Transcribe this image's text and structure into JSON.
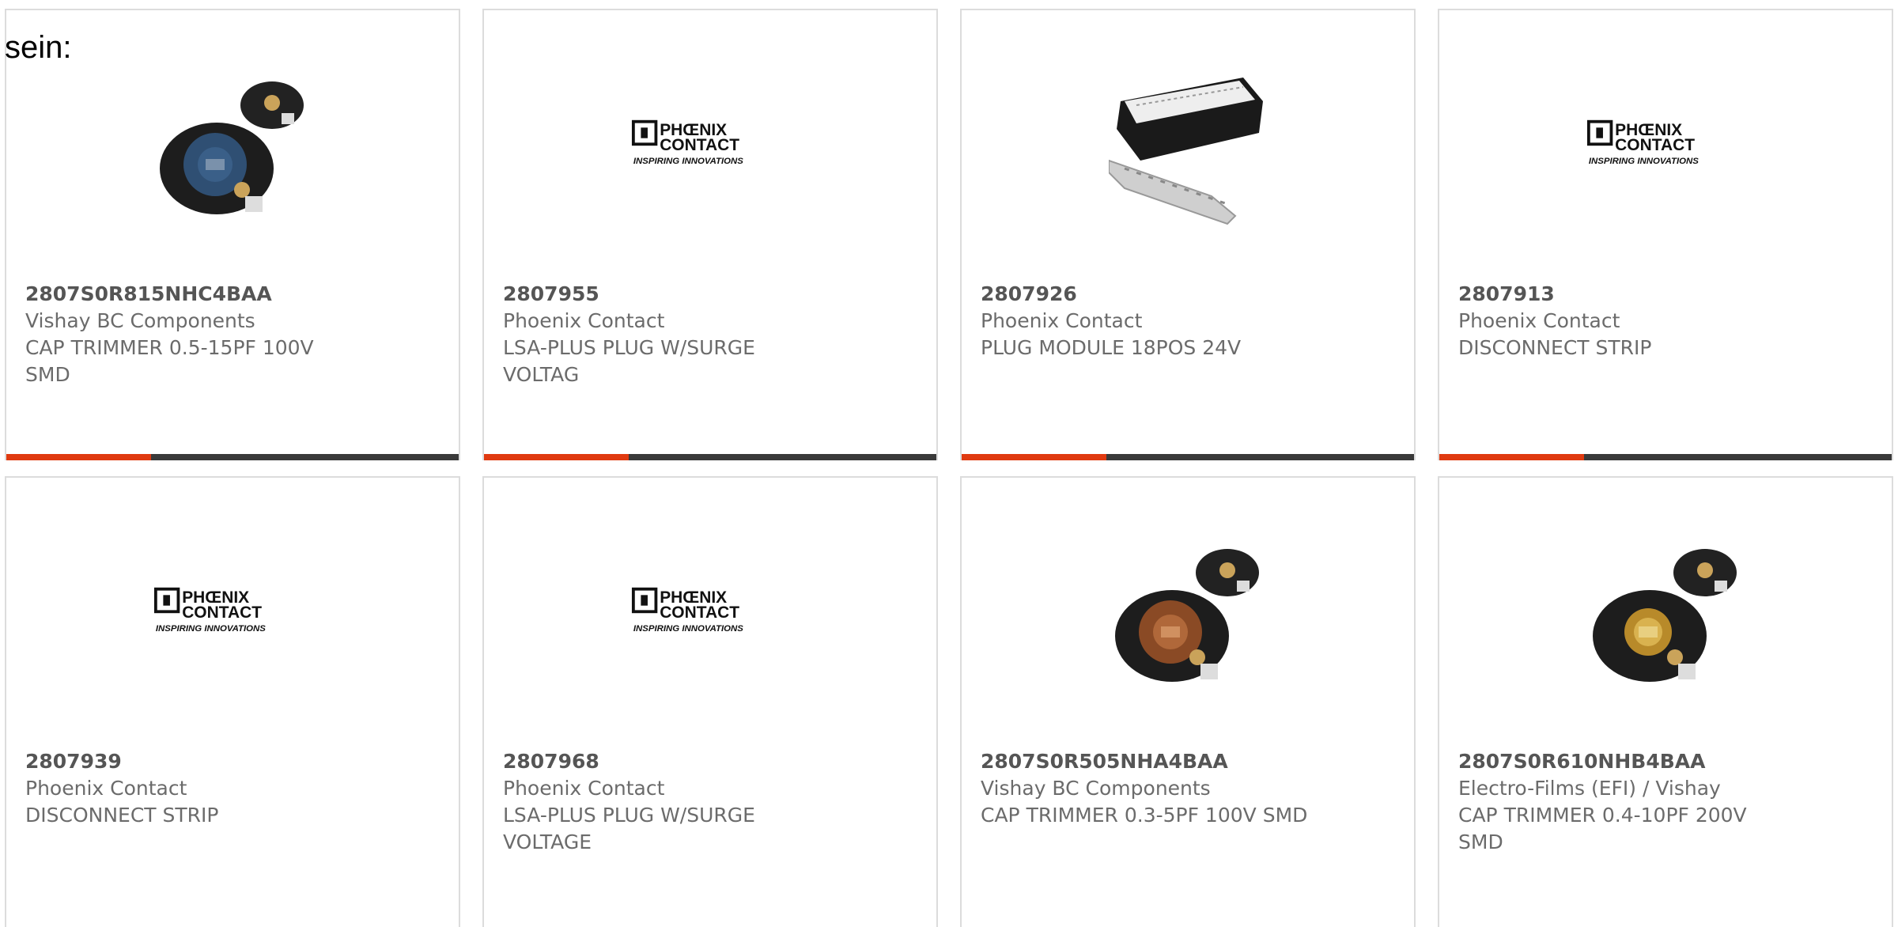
{
  "intro_text": "sein:",
  "colors": {
    "accent": "#e03a10",
    "bar": "#3a3a3a",
    "card_border": "#dcdcdc",
    "text": "#6b6b6b"
  },
  "cards": [
    {
      "pn": "2807S0R815NHC4BAA",
      "mfr": "Vishay BC Components",
      "desc": "CAP TRIMMER 0.5-15PF 100V SMD",
      "image": "trimmer-capacitor-blue",
      "logo_lines": []
    },
    {
      "pn": "2807955",
      "mfr": "Phoenix Contact",
      "desc": "LSA-PLUS PLUG W/SURGE VOLTAG",
      "image": "phoenix-contact-logo",
      "logo_lines": [
        "PHŒNIX",
        "CONTACT",
        "INSPIRING INNOVATIONS"
      ]
    },
    {
      "pn": "2807926",
      "mfr": "Phoenix Contact",
      "desc": "PLUG MODULE 18POS 24V",
      "image": "plug-module",
      "logo_lines": []
    },
    {
      "pn": "2807913",
      "mfr": "Phoenix Contact",
      "desc": "DISCONNECT STRIP",
      "image": "phoenix-contact-logo",
      "logo_lines": [
        "PHŒNIX",
        "CONTACT",
        "INSPIRING INNOVATIONS"
      ]
    },
    {
      "pn": "2807939",
      "mfr": "Phoenix Contact",
      "desc": "DISCONNECT STRIP",
      "image": "phoenix-contact-logo",
      "logo_lines": [
        "PHŒNIX",
        "CONTACT",
        "INSPIRING INNOVATIONS"
      ]
    },
    {
      "pn": "2807968",
      "mfr": "Phoenix Contact",
      "desc": "LSA-PLUS PLUG W/SURGE VOLTAGE",
      "image": "phoenix-contact-logo",
      "logo_lines": [
        "PHŒNIX",
        "CONTACT",
        "INSPIRING INNOVATIONS"
      ]
    },
    {
      "pn": "2807S0R505NHA4BAA",
      "mfr": "Vishay BC Components",
      "desc": "CAP TRIMMER 0.3-5PF 100V SMD",
      "image": "trimmer-capacitor-copper",
      "logo_lines": []
    },
    {
      "pn": "2807S0R610NHB4BAA",
      "mfr": "Electro-Films (EFI) / Vishay",
      "desc": "CAP TRIMMER 0.4-10PF 200V SMD",
      "image": "trimmer-capacitor-gold",
      "logo_lines": []
    }
  ]
}
